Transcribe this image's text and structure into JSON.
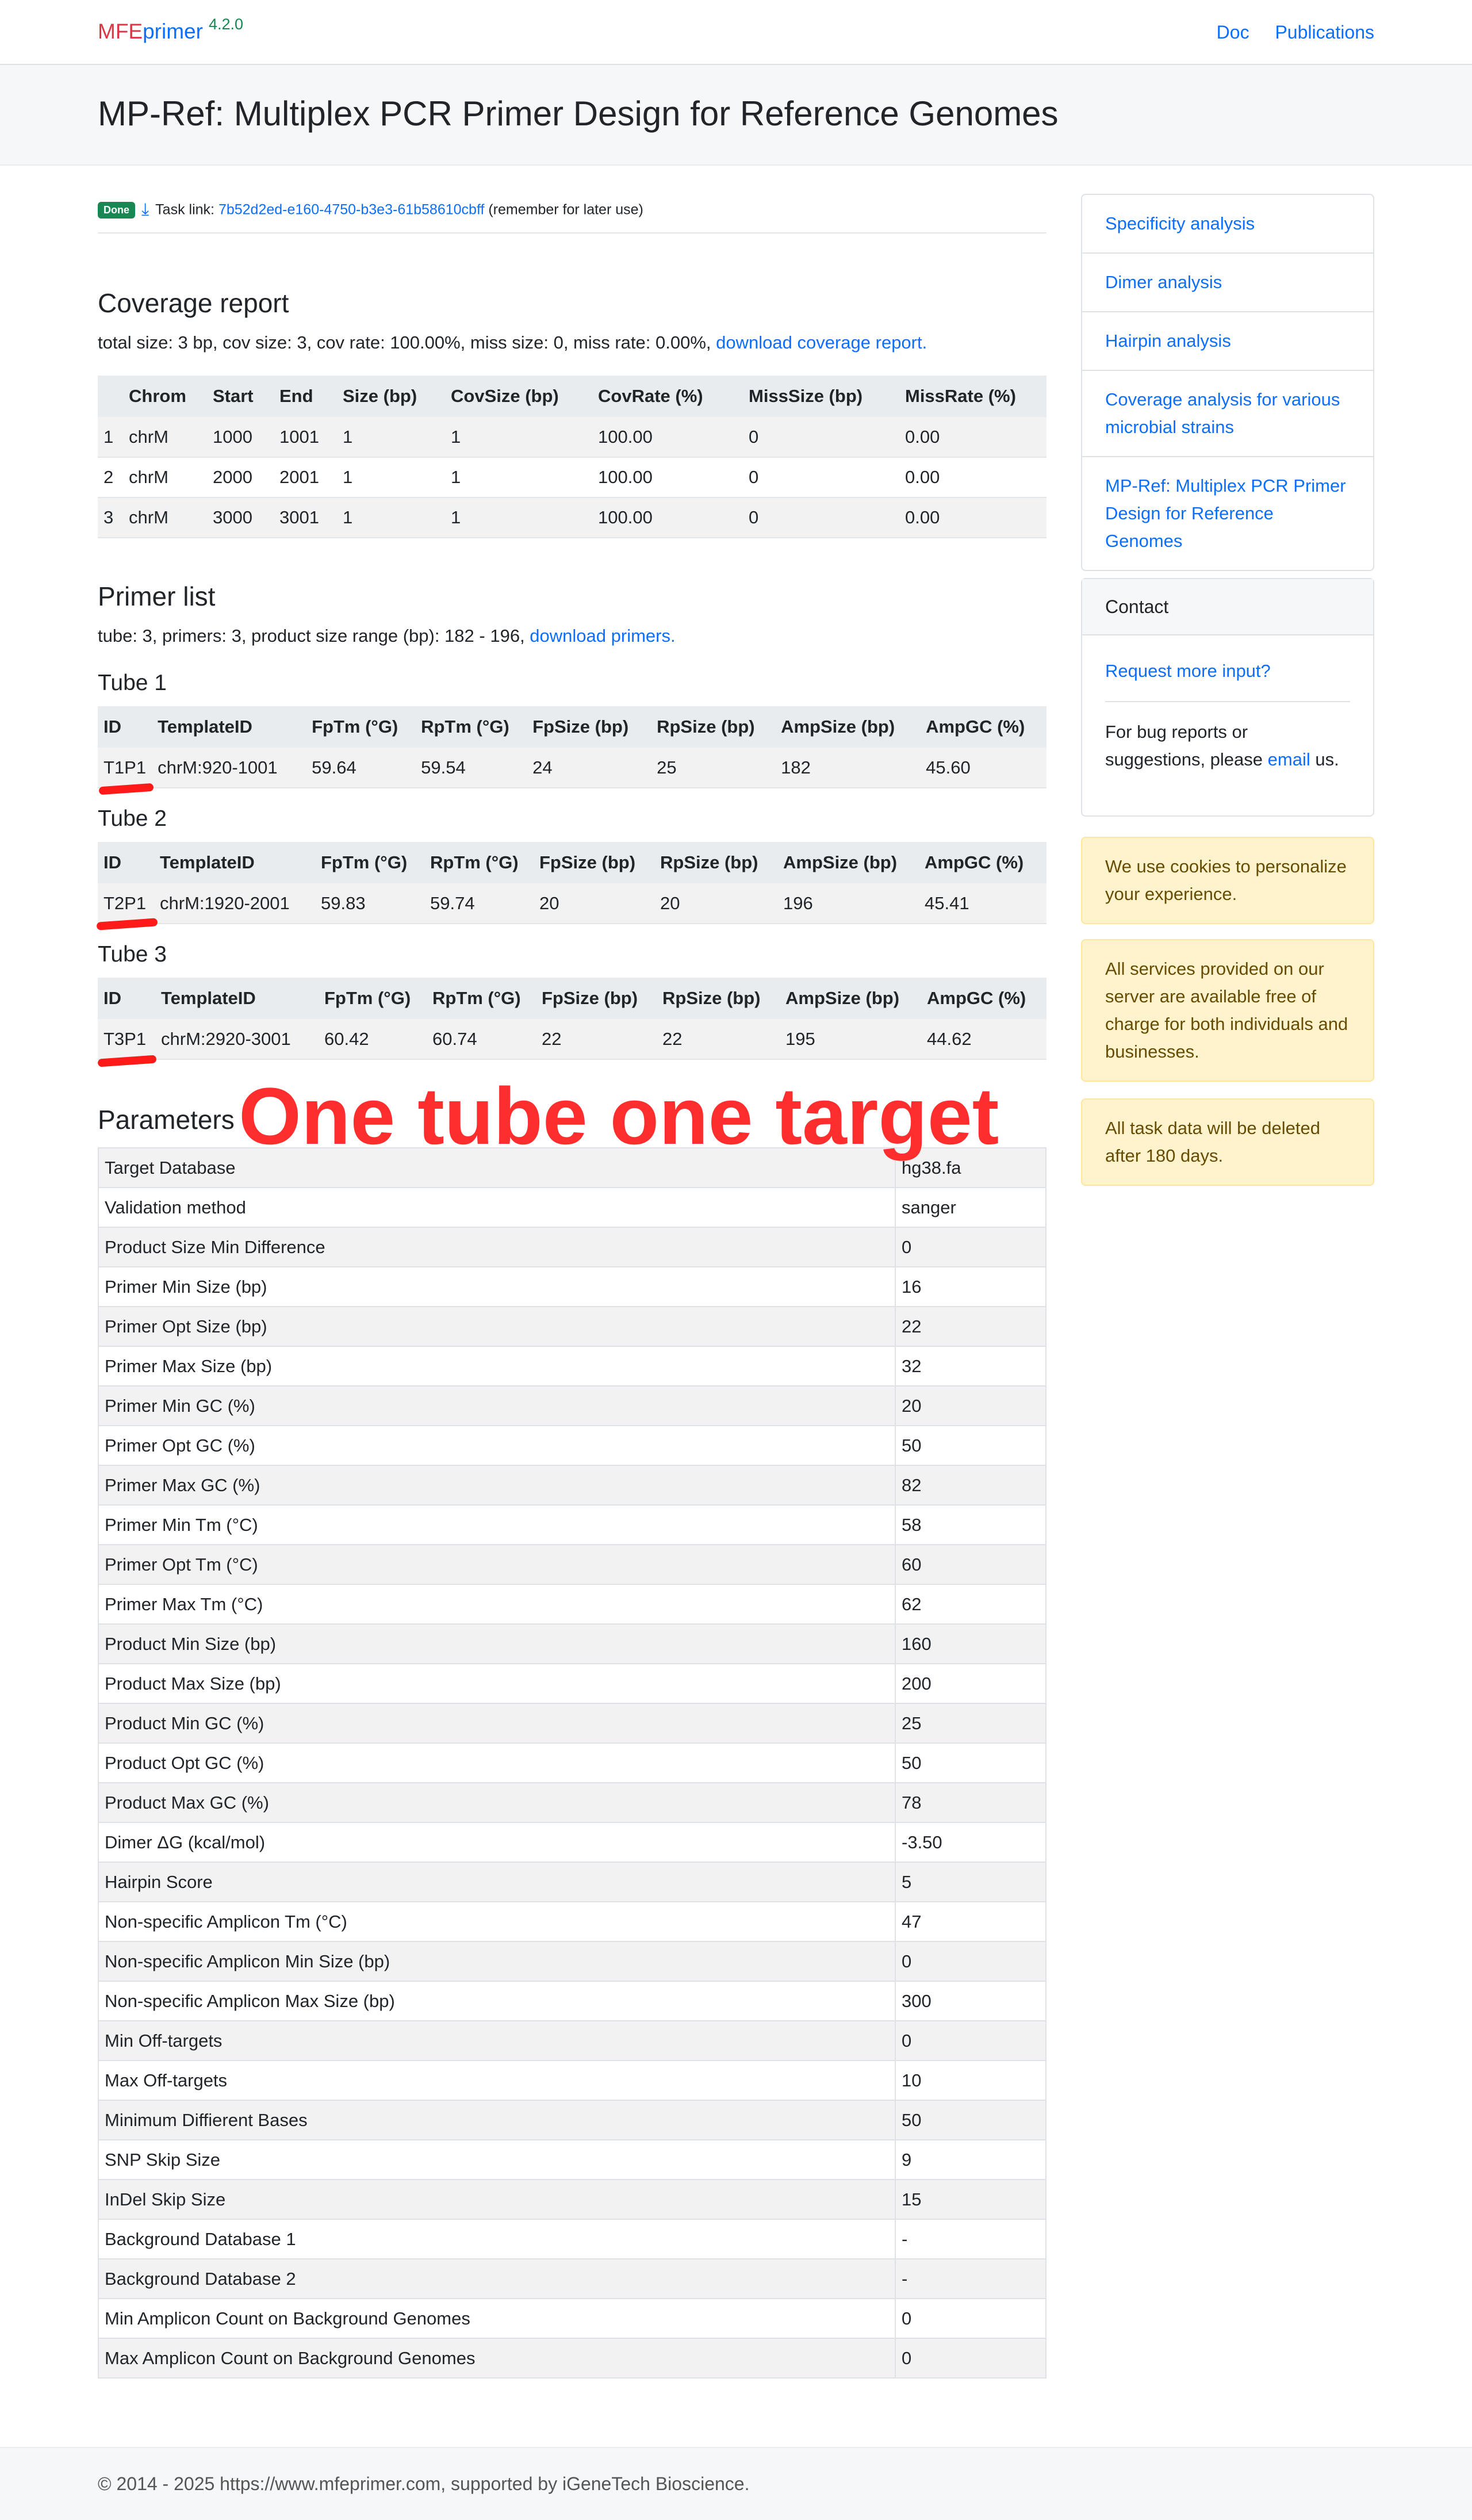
{
  "nav": {
    "brand_mfe": "MFE",
    "brand_primer": "primer",
    "version": "4.2.0",
    "links": [
      "Doc",
      "Publications"
    ]
  },
  "hero": {
    "title": "MP-Ref: Multiplex PCR Primer Design for Reference Genomes"
  },
  "task": {
    "badge": "Done",
    "download_icon": "download-icon",
    "label": "Task link:",
    "id": "7b52d2ed-e160-4750-b3e3-61b58610cbff",
    "note": "(remember for later use)"
  },
  "coverage": {
    "title": "Coverage report",
    "summary": "total size: 3 bp, cov size: 3, cov rate: 100.00%, miss size: 0, miss rate: 0.00%,",
    "download_link": "download coverage report.",
    "headers": [
      "",
      "Chrom",
      "Start",
      "End",
      "Size (bp)",
      "CovSize (bp)",
      "CovRate (%)",
      "MissSize (bp)",
      "MissRate (%)"
    ],
    "rows": [
      [
        "1",
        "chrM",
        "1000",
        "1001",
        "1",
        "1",
        "100.00",
        "0",
        "0.00"
      ],
      [
        "2",
        "chrM",
        "2000",
        "2001",
        "1",
        "1",
        "100.00",
        "0",
        "0.00"
      ],
      [
        "3",
        "chrM",
        "3000",
        "3001",
        "1",
        "1",
        "100.00",
        "0",
        "0.00"
      ]
    ]
  },
  "primers": {
    "title": "Primer list",
    "summary": "tube: 3, primers: 3, product size range (bp): 182 - 196,",
    "download_link": "download primers.",
    "headers": [
      "ID",
      "TemplateID",
      "FpTm (°G)",
      "RpTm (°G)",
      "FpSize (bp)",
      "RpSize (bp)",
      "AmpSize (bp)",
      "AmpGC (%)"
    ],
    "tubes": [
      {
        "title": "Tube 1",
        "row": [
          "T1P1",
          "chrM:920-1001",
          "59.64",
          "59.54",
          "24",
          "25",
          "182",
          "45.60"
        ]
      },
      {
        "title": "Tube 2",
        "row": [
          "T2P1",
          "chrM:1920-2001",
          "59.83",
          "59.74",
          "20",
          "20",
          "196",
          "45.41"
        ]
      },
      {
        "title": "Tube 3",
        "row": [
          "T3P1",
          "chrM:2920-3001",
          "60.42",
          "60.74",
          "22",
          "22",
          "195",
          "44.62"
        ]
      }
    ]
  },
  "annotation": {
    "text": "One tube one target"
  },
  "parameters": {
    "title": "Parameters",
    "rows": [
      [
        "Target Database",
        "hg38.fa"
      ],
      [
        "Validation method",
        "sanger"
      ],
      [
        "Product Size Min Difference",
        "0"
      ],
      [
        "Primer Min Size (bp)",
        "16"
      ],
      [
        "Primer Opt Size (bp)",
        "22"
      ],
      [
        "Primer Max Size (bp)",
        "32"
      ],
      [
        "Primer Min GC (%)",
        "20"
      ],
      [
        "Primer Opt GC (%)",
        "50"
      ],
      [
        "Primer Max GC (%)",
        "82"
      ],
      [
        "Primer Min Tm (°C)",
        "58"
      ],
      [
        "Primer Opt Tm (°C)",
        "60"
      ],
      [
        "Primer Max Tm (°C)",
        "62"
      ],
      [
        "Product Min Size (bp)",
        "160"
      ],
      [
        "Product Max Size (bp)",
        "200"
      ],
      [
        "Product Min GC (%)",
        "25"
      ],
      [
        "Product Opt GC (%)",
        "50"
      ],
      [
        "Product Max GC (%)",
        "78"
      ],
      [
        "Dimer ΔG (kcal/mol)",
        "-3.50"
      ],
      [
        "Hairpin Score",
        "5"
      ],
      [
        "Non-specific Amplicon Tm (°C)",
        "47"
      ],
      [
        "Non-specific Amplicon Min Size (bp)",
        "0"
      ],
      [
        "Non-specific Amplicon Max Size (bp)",
        "300"
      ],
      [
        "Min Off-targets",
        "0"
      ],
      [
        "Max Off-targets",
        "10"
      ],
      [
        "Minimum Diffierent Bases",
        "50"
      ],
      [
        "SNP Skip Size",
        "9"
      ],
      [
        "InDel Skip Size",
        "15"
      ],
      [
        "Background Database 1",
        "-"
      ],
      [
        "Background Database 2",
        "-"
      ],
      [
        "Min Amplicon Count on Background Genomes",
        "0"
      ],
      [
        "Max Amplicon Count on Background Genomes",
        "0"
      ]
    ]
  },
  "sidebar": {
    "links": [
      "Specificity analysis",
      "Dimer analysis",
      "Hairpin analysis",
      "Coverage analysis for various microbial strains",
      "MP-Ref: Multiplex PCR Primer Design for Reference Genomes"
    ],
    "contact": {
      "header": "Contact",
      "request_link": "Request more input?",
      "bug_text_before": "For bug reports or suggestions, please",
      "bug_link": "email",
      "bug_text_after": "us."
    },
    "alerts": [
      "We use cookies to personalize your experience.",
      "All services provided on our server are available free of charge for both individuals and businesses.",
      "All task data will be deleted after 180 days."
    ]
  },
  "footer": {
    "text": "© 2014 - 2025 https://www.mfeprimer.com, supported by iGeneTech Bioscience."
  }
}
